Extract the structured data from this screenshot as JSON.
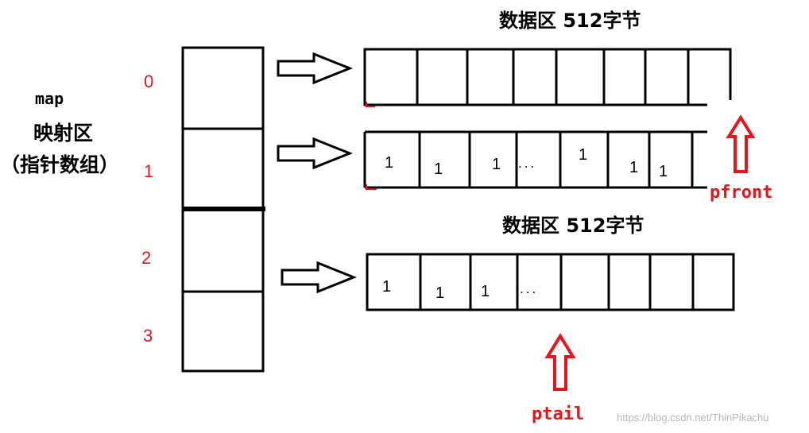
{
  "map": {
    "title": "map",
    "subtitle_line1": "映射区",
    "subtitle_line2": "（指针数组）",
    "indices": [
      "0",
      "1",
      "2",
      "3"
    ]
  },
  "buffers": {
    "header_top": "数据区  512字节",
    "header_mid": "数据区  512字节",
    "row1_values": [
      "1",
      "1",
      "1",
      "...",
      "1",
      "1",
      "1"
    ],
    "row2_values": [
      "1",
      "1",
      "1",
      "..."
    ]
  },
  "pointers": {
    "front": "pfront",
    "tail": "ptail"
  },
  "watermark": "https://blog.csdn.net/ThinPikachu",
  "colors": {
    "line": "#000000",
    "accent": "#e8141a"
  }
}
